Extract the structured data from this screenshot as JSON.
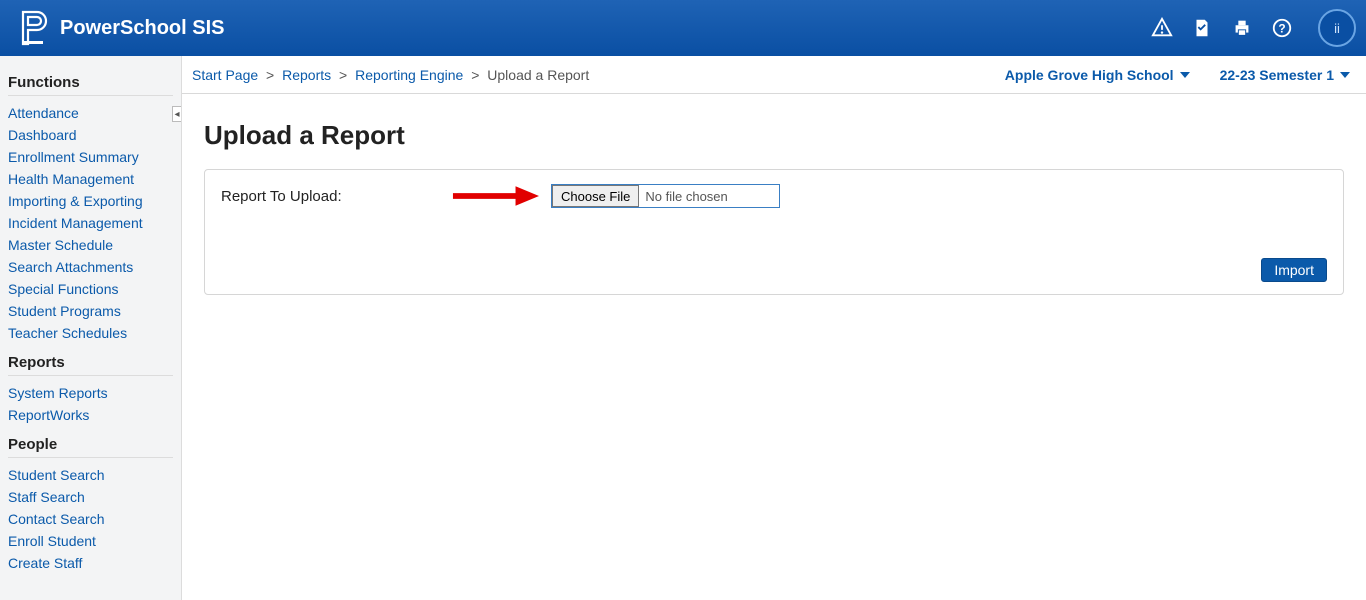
{
  "header": {
    "app_title": "PowerSchool SIS",
    "avatar_text": "ii"
  },
  "sidebar": {
    "functions_heading": "Functions",
    "functions": [
      "Attendance",
      "Dashboard",
      "Enrollment Summary",
      "Health Management",
      "Importing & Exporting",
      "Incident Management",
      "Master Schedule",
      "Search Attachments",
      "Special Functions",
      "Student Programs",
      "Teacher Schedules"
    ],
    "reports_heading": "Reports",
    "reports": [
      "System Reports",
      "ReportWorks"
    ],
    "people_heading": "People",
    "people": [
      "Student Search",
      "Staff Search",
      "Contact Search",
      "Enroll Student",
      "Create Staff"
    ]
  },
  "breadcrumb": {
    "items": [
      "Start Page",
      "Reports",
      "Reporting Engine"
    ],
    "current": "Upload a Report"
  },
  "context": {
    "school": "Apple Grove High School",
    "term": "22-23 Semester 1"
  },
  "page": {
    "title": "Upload a Report",
    "form_label": "Report To Upload:",
    "choose_file_label": "Choose File",
    "file_status": "No file chosen",
    "import_label": "Import"
  }
}
